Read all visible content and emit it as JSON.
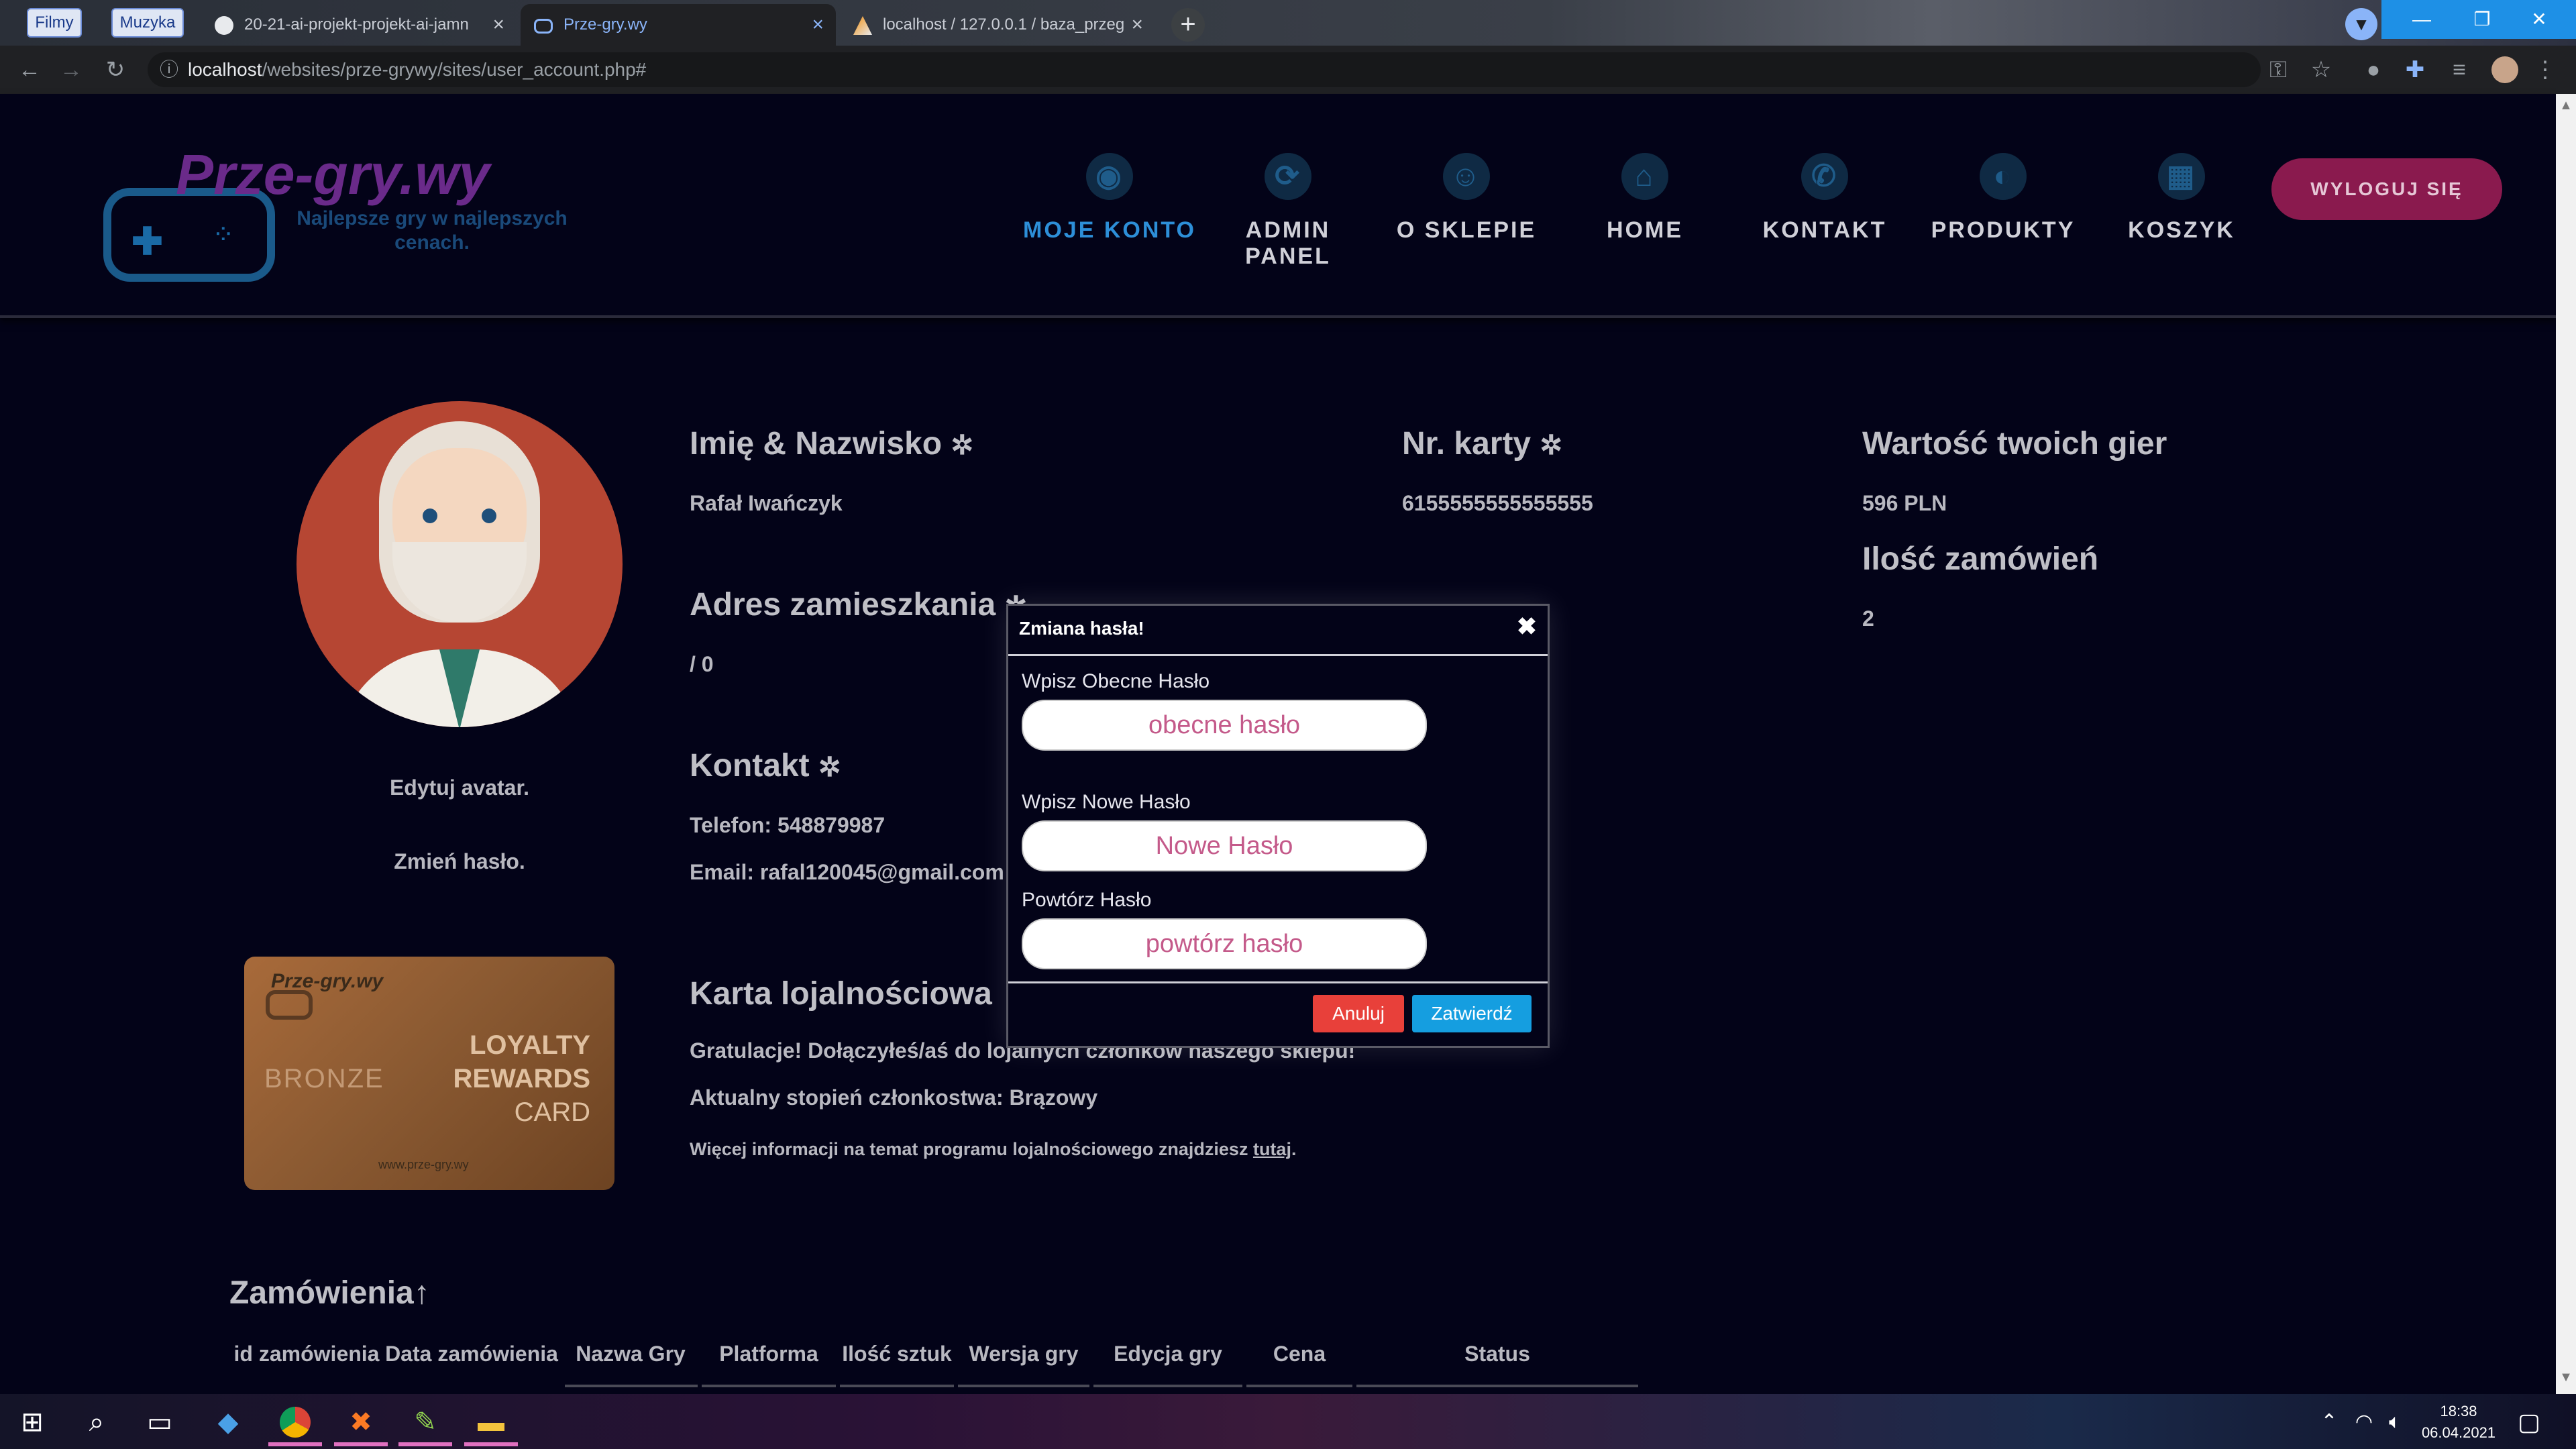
{
  "browser": {
    "bookmarks": [
      "Filmy",
      "Muzyka"
    ],
    "tabs": [
      {
        "title": "20-21-ai-projekt-projekt-ai-jamn",
        "active": false
      },
      {
        "title": "Prze-gry.wy",
        "active": true
      },
      {
        "title": "localhost / 127.0.0.1 / baza_przeg",
        "active": false
      }
    ],
    "url": "localhost/websites/prze-grywy/sites/user_account.php#",
    "url_host": "localhost",
    "url_path": "/websites/prze-grywy/sites/user_account.php#"
  },
  "site": {
    "logo_text": "Prze-gry.wy",
    "logo_tagline": "Najlepsze gry w najlepszych cenach.",
    "nav": [
      {
        "label": "MOJE KONTO",
        "icon": "account-icon",
        "active": true
      },
      {
        "label": "ADMIN PANEL",
        "icon": "admin-icon",
        "active": false
      },
      {
        "label": "O SKLEPIE",
        "icon": "about-icon",
        "active": false
      },
      {
        "label": "HOME",
        "icon": "home-icon",
        "active": false
      },
      {
        "label": "KONTAKT",
        "icon": "phone-icon",
        "active": false
      },
      {
        "label": "PRODUKTY",
        "icon": "controller-icon",
        "active": false
      },
      {
        "label": "KOSZYK",
        "icon": "cart-icon",
        "active": false
      }
    ],
    "logout_label": "WYLOGUJ SIĘ"
  },
  "account": {
    "edit_avatar": "Edytuj avatar.",
    "change_password": "Zmień hasło.",
    "name_heading": "Imię & Nazwisko",
    "name_value": "Rafał Iwańczyk",
    "address_heading": "Adres zamieszkania",
    "address_value": "/ 0",
    "contact_heading": "Kontakt",
    "phone": "Telefon: 548879987",
    "email": "Email: rafal120045@gmail.com",
    "card_heading": "Nr. karty",
    "card_value": "6155555555555555",
    "games_value_heading": "Wartość twoich gier",
    "games_value": "596 PLN",
    "orders_count_heading": "Ilość zamówień",
    "orders_count": "2",
    "loyalty_heading": "Karta lojalnościowa",
    "loyalty_congrats": "Gratulacje! Dołączyłeś/aś do lojalnych członków naszego sklepu!",
    "loyalty_level": "Aktualny stopień członkostwa: Brązowy",
    "loyalty_info_prefix": "Więcej informacji na temat programu lojalnościowego znajdziesz ",
    "loyalty_info_link": "tutaj",
    "loyalty_info_suffix": "."
  },
  "loyalty_card": {
    "logo": "Prze-gry.wy",
    "tier": "BRONZE",
    "line1": "LOYALTY",
    "line2": "REWARDS",
    "line3": "CARD",
    "site": "www.prze-gry.wy"
  },
  "orders": {
    "heading": "Zamówienia↑",
    "columns": [
      "id zamówienia",
      "Data zamówienia",
      "Nazwa Gry",
      "Platforma",
      "Ilość sztuk",
      "Wersja gry",
      "Edycja gry",
      "Cena",
      "Status"
    ]
  },
  "modal": {
    "title": "Zmiana hasła!",
    "current_label": "Wpisz Obecne Hasło",
    "current_placeholder": "obecne hasło",
    "new_label": "Wpisz Nowe Hasło",
    "new_placeholder": "Nowe Hasło",
    "repeat_label": "Powtórz Hasło",
    "repeat_placeholder": "powtórz hasło",
    "cancel": "Anuluj",
    "confirm": "Zatwierdź",
    "cancel_color": "#e8403a",
    "confirm_color": "#159ee0"
  },
  "taskbar": {
    "time": "18:38",
    "date": "06.04.2021"
  }
}
